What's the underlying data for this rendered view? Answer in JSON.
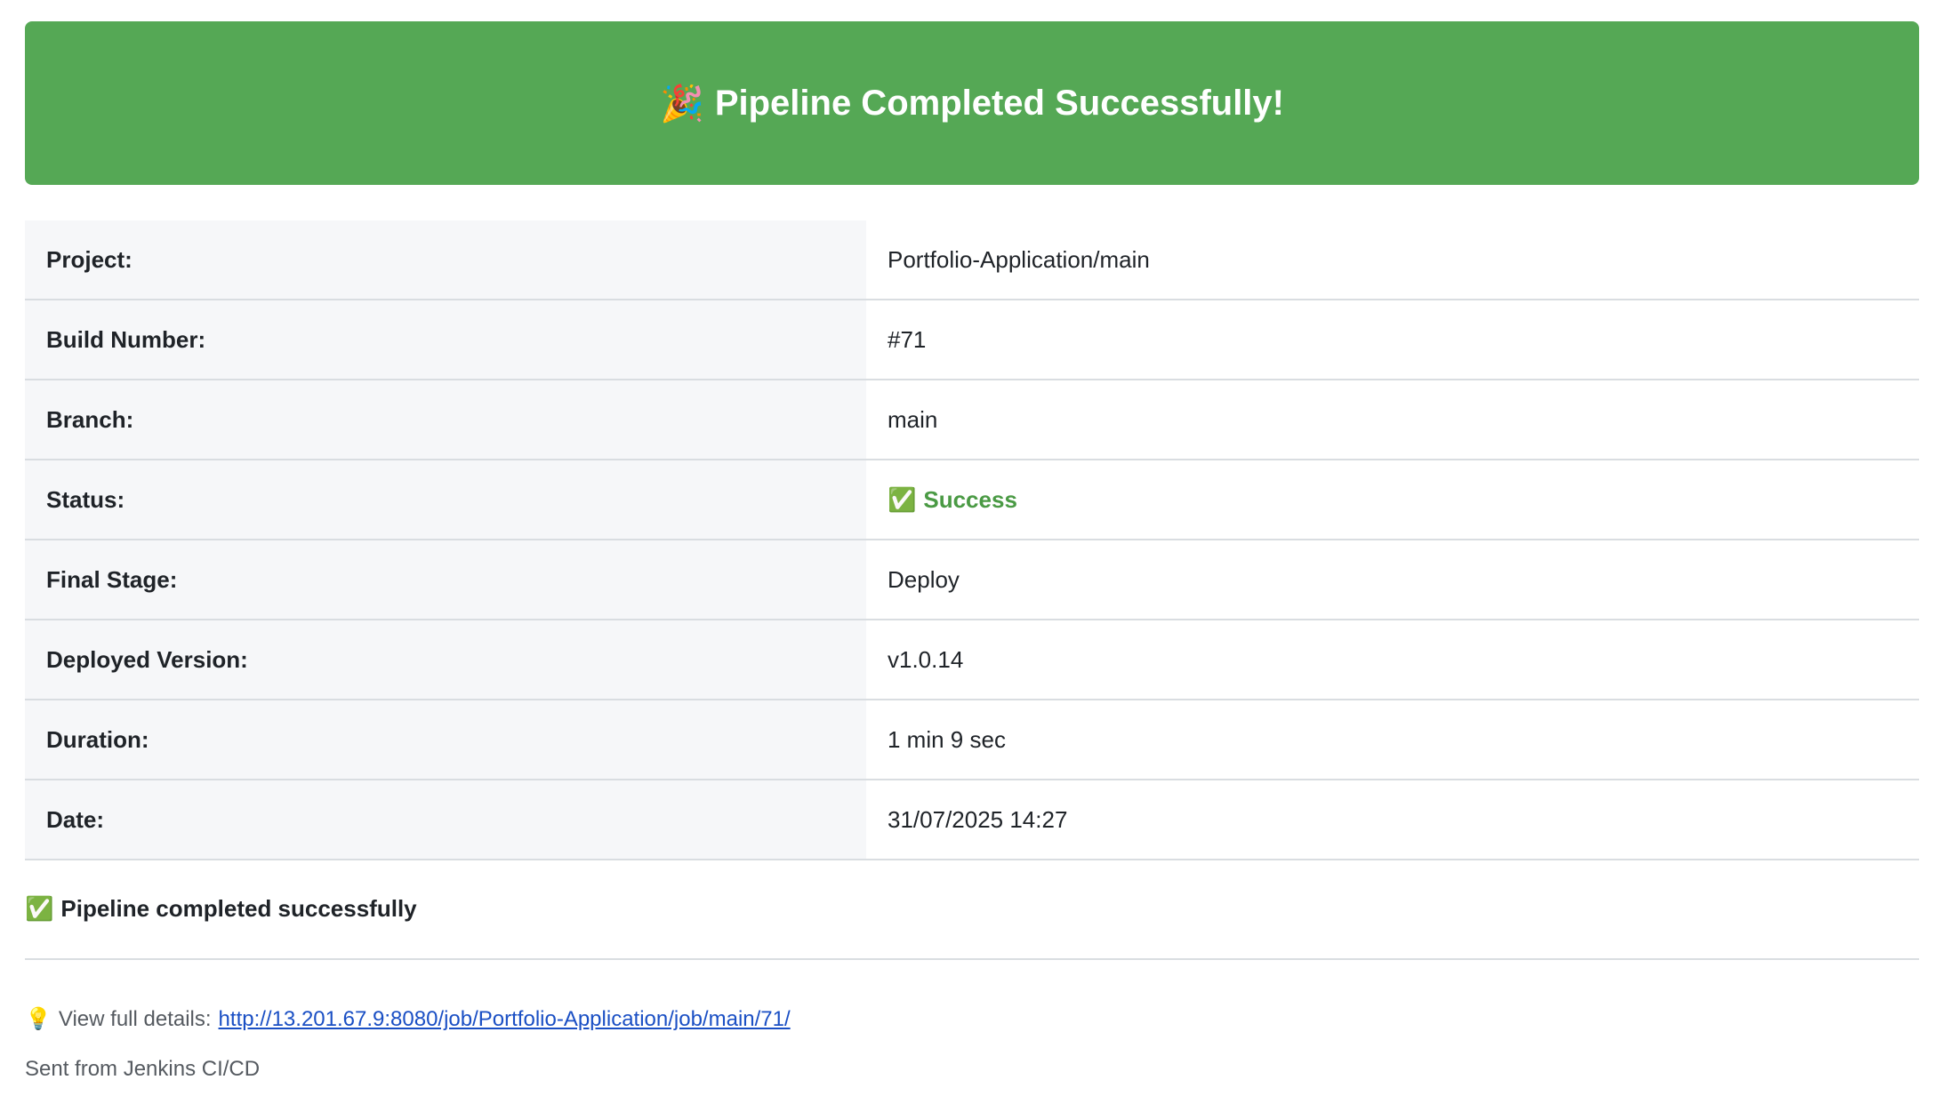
{
  "banner": {
    "emoji": "🎉",
    "title": "Pipeline Completed Successfully!",
    "background_color": "#55a855"
  },
  "details": [
    {
      "label": "Project:",
      "value": "Portfolio-Application/main"
    },
    {
      "label": "Build Number:",
      "value": "#71"
    },
    {
      "label": "Branch:",
      "value": "main"
    },
    {
      "label": "Status:",
      "value": "Success",
      "value_icon": "✅",
      "value_color": "#4a9a44"
    },
    {
      "label": "Final Stage:",
      "value": "Deploy"
    },
    {
      "label": "Deployed Version:",
      "value": "v1.0.14"
    },
    {
      "label": "Duration:",
      "value": "1 min 9 sec"
    },
    {
      "label": "Date:",
      "value": "31/07/2025 14:27"
    }
  ],
  "summary": {
    "icon": "✅",
    "text": "Pipeline completed successfully"
  },
  "footer": {
    "icon": "💡",
    "link_prefix": "View full details:",
    "link_text": "http://13.201.67.9:8080/job/Portfolio-Application/job/main/71/",
    "sent_from": "Sent from Jenkins CI/CD"
  }
}
